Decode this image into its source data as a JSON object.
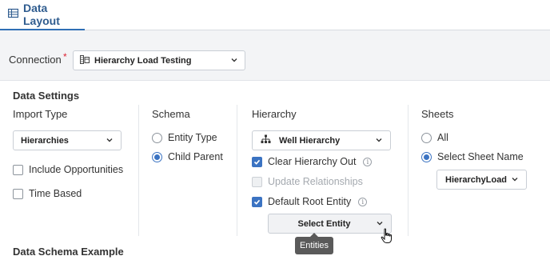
{
  "tabs": [
    {
      "label": "Data Layout",
      "active": true
    }
  ],
  "connection": {
    "label": "Connection",
    "required_mark": "*",
    "value": "Hierarchy Load Testing"
  },
  "settings": {
    "title": "Data Settings",
    "import_type": {
      "title": "Import Type",
      "selected": "Hierarchies",
      "options": [
        {
          "label": "Include Opportunities",
          "checked": false
        },
        {
          "label": "Time Based",
          "checked": false
        }
      ]
    },
    "schema": {
      "title": "Schema",
      "options": [
        {
          "label": "Entity Type",
          "selected": false
        },
        {
          "label": "Child Parent",
          "selected": true
        }
      ]
    },
    "hierarchy": {
      "title": "Hierarchy",
      "selected": "Well Hierarchy",
      "options": [
        {
          "label": "Clear Hierarchy Out",
          "checked": true,
          "info": true,
          "disabled": false
        },
        {
          "label": "Update Relationships",
          "checked": false,
          "info": false,
          "disabled": true
        },
        {
          "label": "Default Root Entity",
          "checked": true,
          "info": true,
          "disabled": false
        }
      ],
      "select_entity_label": "Select Entity",
      "tooltip": "Entities"
    },
    "sheets": {
      "title": "Sheets",
      "options": [
        {
          "label": "All",
          "selected": false
        },
        {
          "label": "Select Sheet Name",
          "selected": true
        }
      ],
      "sheet_name": "HierarchyLoad"
    }
  },
  "schema_example": {
    "title": "Data Schema Example"
  },
  "colors": {
    "accent": "#3b73c2",
    "tab_active": "#2f5c8f",
    "required": "#dd2233"
  }
}
